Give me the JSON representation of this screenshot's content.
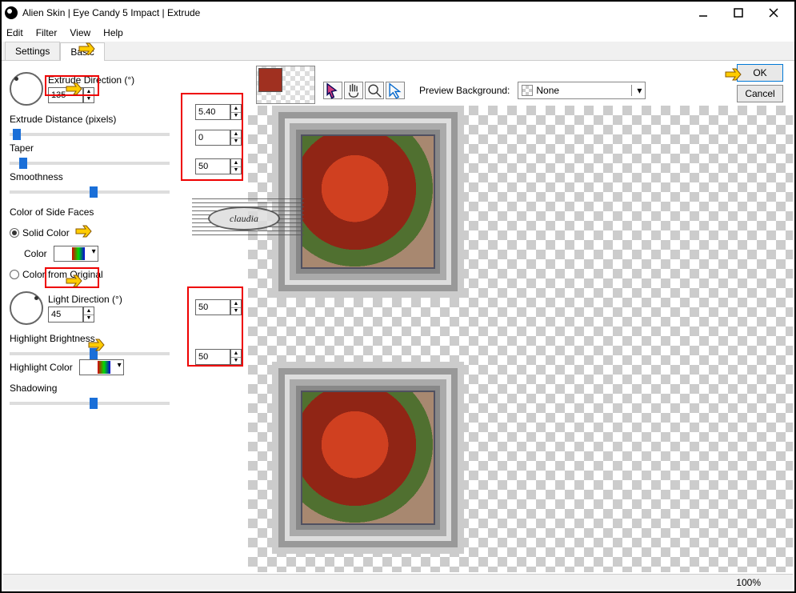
{
  "window": {
    "title": "Alien Skin | Eye Candy 5 Impact | Extrude",
    "minimize": "–",
    "maximize": "□",
    "close": "×"
  },
  "menu": {
    "edit": "Edit",
    "filter": "Filter",
    "view": "View",
    "help": "Help"
  },
  "tabs": {
    "settings": "Settings",
    "basic": "Basic"
  },
  "buttons": {
    "ok": "OK",
    "cancel": "Cancel"
  },
  "preview": {
    "bg_label": "Preview Background:",
    "bg_value": "None"
  },
  "controls": {
    "extrude_direction": {
      "label": "Extrude Direction (°)",
      "value": "135"
    },
    "extrude_distance": {
      "label": "Extrude Distance (pixels)",
      "value": "5.40"
    },
    "taper": {
      "label": "Taper",
      "value": "0"
    },
    "smoothness": {
      "label": "Smoothness",
      "value": "50"
    },
    "side_faces_header": "Color of Side Faces",
    "solid_color": "Solid Color",
    "color_label": "Color",
    "color_from_original": "Color from Original",
    "light_direction": {
      "label": "Light Direction (°)",
      "value": "45"
    },
    "highlight_brightness": {
      "label": "Highlight Brightness",
      "value": "50"
    },
    "highlight_color": "Highlight Color",
    "shadowing": {
      "label": "Shadowing",
      "value": "50"
    }
  },
  "status": {
    "zoom": "100%"
  },
  "watermark": "claudia"
}
